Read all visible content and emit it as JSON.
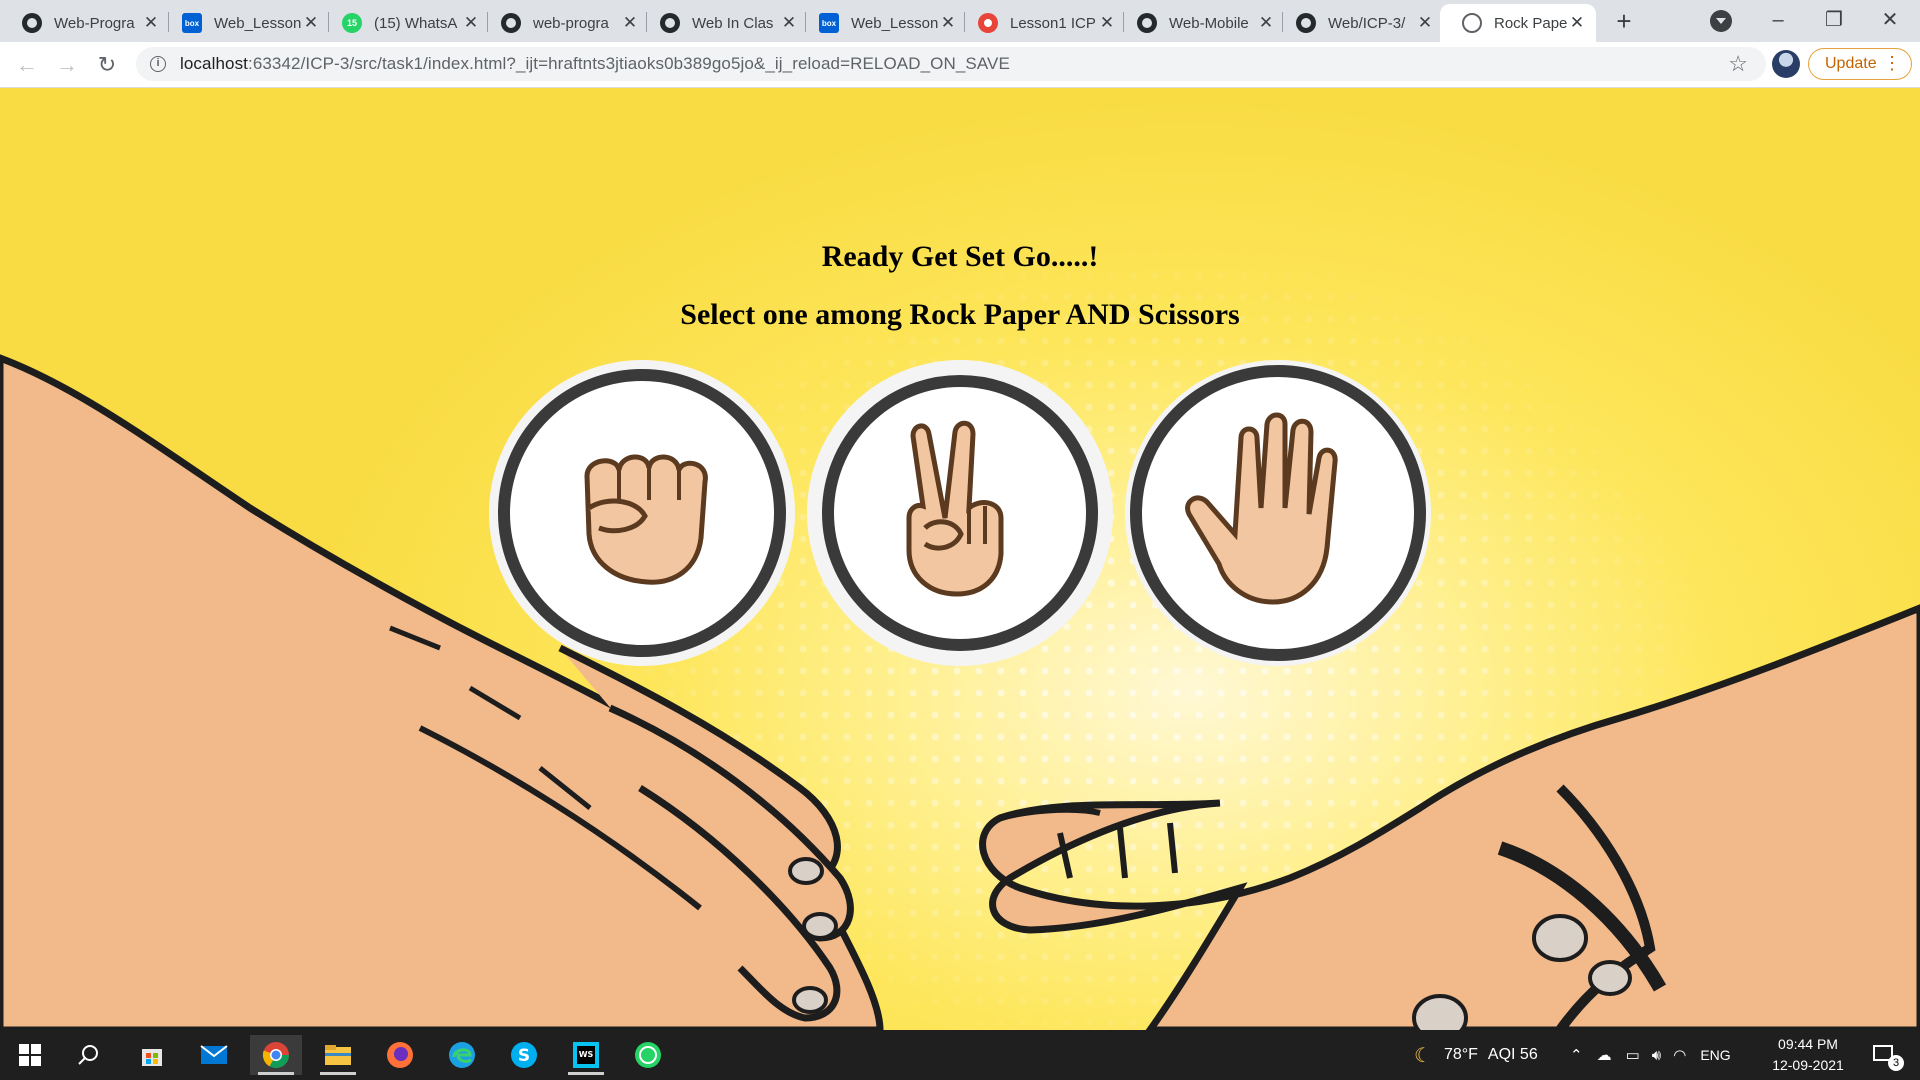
{
  "browser": {
    "tabs": [
      {
        "label": "Web-Progra",
        "favicon": "github-icon"
      },
      {
        "label": "Web_Lesson",
        "favicon": "box-icon"
      },
      {
        "label": "(15) WhatsA",
        "favicon": "whatsapp-icon",
        "badge": "15"
      },
      {
        "label": "web-progra",
        "favicon": "github-icon"
      },
      {
        "label": "Web In Clas",
        "favicon": "github-icon"
      },
      {
        "label": "Web_Lesson",
        "favicon": "box-icon"
      },
      {
        "label": "Lesson1 ICP",
        "favicon": "lesson-icon"
      },
      {
        "label": "Web-Mobile",
        "favicon": "github-icon"
      },
      {
        "label": "Web/ICP-3/",
        "favicon": "github-icon"
      },
      {
        "label": "Rock Paper",
        "favicon": "globe-icon",
        "active": true
      }
    ],
    "favicon_labels": {
      "box": "box"
    },
    "url_host": "localhost",
    "url_rest": ":63342/ICP-3/src/task1/index.html?_ijt=hraftnts3jtiaoks0b389go5jo&_ij_reload=RELOAD_ON_SAVE",
    "update_label": "Update",
    "accent": "#c26401"
  },
  "page": {
    "heading_ready": "Ready Get Set Go.....!",
    "heading_select": "Select one among Rock Paper AND Scissors",
    "choices": [
      "rock",
      "scissors",
      "paper"
    ],
    "background_color": "#fde65a"
  },
  "taskbar": {
    "weather_temp": "78°F",
    "weather_aqi": "AQI 56",
    "language": "ENG",
    "time": "09:44 PM",
    "date": "12-09-2021",
    "notification_count": "3"
  }
}
